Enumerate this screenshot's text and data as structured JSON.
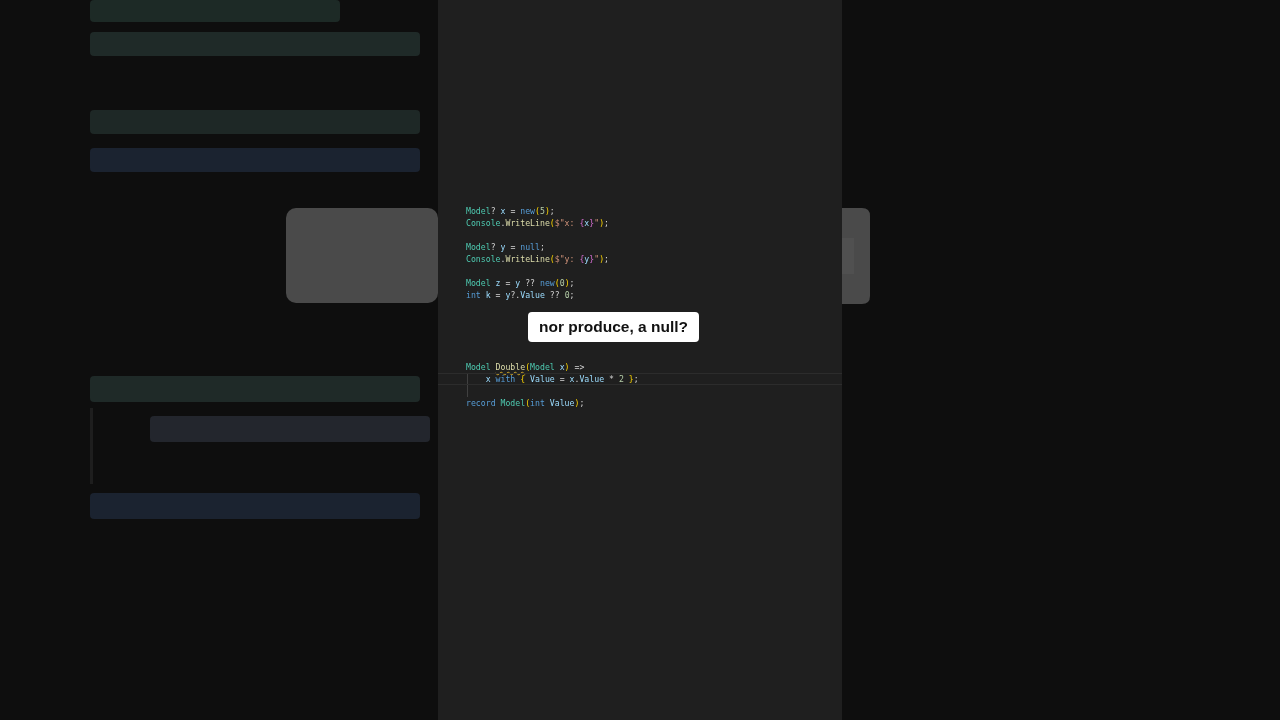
{
  "code_lines": [
    {
      "kind": "code",
      "current": false,
      "indent_guide": false,
      "tokens": [
        {
          "text": "Model",
          "kind": "type"
        },
        {
          "text": "? ",
          "kind": "punct"
        },
        {
          "text": "x",
          "kind": "var"
        },
        {
          "text": " = ",
          "kind": "punct"
        },
        {
          "text": "new",
          "kind": "keyword"
        },
        {
          "text": "(",
          "kind": "paren"
        },
        {
          "text": "5",
          "kind": "number"
        },
        {
          "text": ")",
          "kind": "paren"
        },
        {
          "text": ";",
          "kind": "punct"
        }
      ]
    },
    {
      "kind": "code",
      "current": false,
      "indent_guide": false,
      "tokens": [
        {
          "text": "Console",
          "kind": "type"
        },
        {
          "text": ".",
          "kind": "punct"
        },
        {
          "text": "WriteLine",
          "kind": "method"
        },
        {
          "text": "(",
          "kind": "paren"
        },
        {
          "text": "$\"x: ",
          "kind": "string"
        },
        {
          "text": "{",
          "kind": "brace"
        },
        {
          "text": "x",
          "kind": "var"
        },
        {
          "text": "}",
          "kind": "brace"
        },
        {
          "text": "\"",
          "kind": "string"
        },
        {
          "text": ")",
          "kind": "paren"
        },
        {
          "text": ";",
          "kind": "punct"
        }
      ]
    },
    {
      "kind": "blank",
      "current": false,
      "indent_guide": false
    },
    {
      "kind": "code",
      "current": false,
      "indent_guide": false,
      "tokens": [
        {
          "text": "Model",
          "kind": "type"
        },
        {
          "text": "? ",
          "kind": "punct"
        },
        {
          "text": "y",
          "kind": "var"
        },
        {
          "text": " = ",
          "kind": "punct"
        },
        {
          "text": "null",
          "kind": "keyword"
        },
        {
          "text": ";",
          "kind": "punct"
        }
      ]
    },
    {
      "kind": "code",
      "current": false,
      "indent_guide": false,
      "tokens": [
        {
          "text": "Console",
          "kind": "type"
        },
        {
          "text": ".",
          "kind": "punct"
        },
        {
          "text": "WriteLine",
          "kind": "method"
        },
        {
          "text": "(",
          "kind": "paren"
        },
        {
          "text": "$\"y: ",
          "kind": "string"
        },
        {
          "text": "{",
          "kind": "brace"
        },
        {
          "text": "y",
          "kind": "var"
        },
        {
          "text": "}",
          "kind": "brace"
        },
        {
          "text": "\"",
          "kind": "string"
        },
        {
          "text": ")",
          "kind": "paren"
        },
        {
          "text": ";",
          "kind": "punct"
        }
      ]
    },
    {
      "kind": "blank",
      "current": false,
      "indent_guide": false
    },
    {
      "kind": "code",
      "current": false,
      "indent_guide": false,
      "tokens": [
        {
          "text": "Model ",
          "kind": "type"
        },
        {
          "text": "z",
          "kind": "var"
        },
        {
          "text": " = ",
          "kind": "punct"
        },
        {
          "text": "y",
          "kind": "var"
        },
        {
          "text": " ?? ",
          "kind": "punct"
        },
        {
          "text": "new",
          "kind": "keyword"
        },
        {
          "text": "(",
          "kind": "paren"
        },
        {
          "text": "0",
          "kind": "number"
        },
        {
          "text": ")",
          "kind": "paren"
        },
        {
          "text": ";",
          "kind": "punct"
        }
      ]
    },
    {
      "kind": "code",
      "current": false,
      "indent_guide": false,
      "tokens": [
        {
          "text": "int ",
          "kind": "keyword"
        },
        {
          "text": "k",
          "kind": "var"
        },
        {
          "text": " = ",
          "kind": "punct"
        },
        {
          "text": "y",
          "kind": "var"
        },
        {
          "text": "?.",
          "kind": "punct"
        },
        {
          "text": "Value",
          "kind": "var"
        },
        {
          "text": " ?? ",
          "kind": "punct"
        },
        {
          "text": "0",
          "kind": "number"
        },
        {
          "text": ";",
          "kind": "punct"
        }
      ]
    },
    {
      "kind": "blank",
      "current": false,
      "indent_guide": false
    },
    {
      "kind": "blank",
      "current": false,
      "indent_guide": false
    },
    {
      "kind": "blank",
      "current": false,
      "indent_guide": false
    },
    {
      "kind": "blank",
      "current": false,
      "indent_guide": false
    },
    {
      "kind": "blank",
      "current": false,
      "indent_guide": false
    },
    {
      "kind": "code",
      "current": false,
      "indent_guide": false,
      "tokens": [
        {
          "text": "Model ",
          "kind": "type"
        },
        {
          "text": "Double",
          "kind": "method",
          "squiggle": true
        },
        {
          "text": "(",
          "kind": "paren"
        },
        {
          "text": "Model ",
          "kind": "type"
        },
        {
          "text": "x",
          "kind": "var"
        },
        {
          "text": ")",
          "kind": "paren"
        },
        {
          "text": " =>",
          "kind": "punct"
        }
      ]
    },
    {
      "kind": "code",
      "current": true,
      "indent_guide": true,
      "tokens": [
        {
          "text": "    x ",
          "kind": "var"
        },
        {
          "text": "with ",
          "kind": "keyword"
        },
        {
          "text": "{ ",
          "kind": "paren"
        },
        {
          "text": "Value",
          "kind": "var"
        },
        {
          "text": " = ",
          "kind": "punct"
        },
        {
          "text": "x",
          "kind": "var"
        },
        {
          "text": ".",
          "kind": "punct"
        },
        {
          "text": "Value",
          "kind": "var"
        },
        {
          "text": " * ",
          "kind": "punct"
        },
        {
          "text": "2 ",
          "kind": "number"
        },
        {
          "text": "}",
          "kind": "paren"
        },
        {
          "text": ";",
          "kind": "punct"
        }
      ]
    },
    {
      "kind": "blank",
      "current": false,
      "indent_guide": true
    },
    {
      "kind": "code",
      "current": false,
      "indent_guide": false,
      "tokens": [
        {
          "text": "record ",
          "kind": "keyword"
        },
        {
          "text": "Model",
          "kind": "type"
        },
        {
          "text": "(",
          "kind": "paren"
        },
        {
          "text": "int ",
          "kind": "keyword"
        },
        {
          "text": "Value",
          "kind": "var"
        },
        {
          "text": ")",
          "kind": "paren"
        },
        {
          "text": ";",
          "kind": "punct"
        }
      ]
    }
  ],
  "caption": "nor produce, a null?"
}
